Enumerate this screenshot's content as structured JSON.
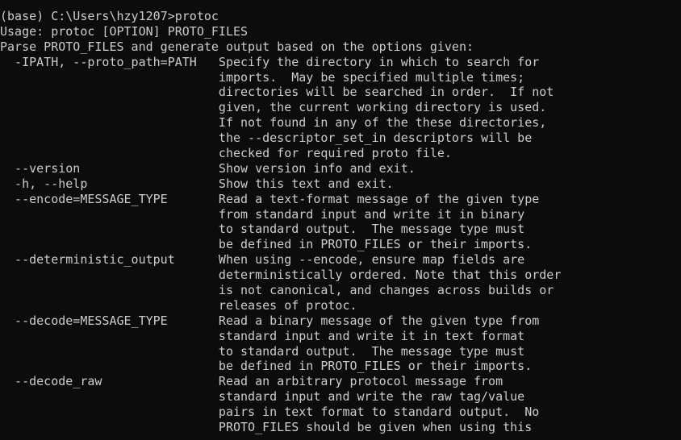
{
  "terminal": {
    "background_color": "#0c0c0c",
    "text_color": "#cccccc",
    "lines": [
      "(base) C:\\Users\\hzy1207>protoc",
      "Usage: protoc [OPTION] PROTO_FILES",
      "Parse PROTO_FILES and generate output based on the options given:",
      "  -IPATH, --proto_path=PATH   Specify the directory in which to search for",
      "                              imports.  May be specified multiple times;",
      "                              directories will be searched in order.  If not",
      "                              given, the current working directory is used.",
      "                              If not found in any of the these directories,",
      "                              the --descriptor_set_in descriptors will be",
      "                              checked for required proto file.",
      "  --version                   Show version info and exit.",
      "  -h, --help                  Show this text and exit.",
      "  --encode=MESSAGE_TYPE       Read a text-format message of the given type",
      "                              from standard input and write it in binary",
      "                              to standard output.  The message type must",
      "                              be defined in PROTO_FILES or their imports.",
      "  --deterministic_output      When using --encode, ensure map fields are",
      "                              deterministically ordered. Note that this order",
      "                              is not canonical, and changes across builds or",
      "                              releases of protoc.",
      "  --decode=MESSAGE_TYPE       Read a binary message of the given type from",
      "                              standard input and write it in text format",
      "                              to standard output.  The message type must",
      "                              be defined in PROTO_FILES or their imports.",
      "  --decode_raw                Read an arbitrary protocol message from",
      "                              standard input and write the raw tag/value",
      "                              pairs in text format to standard output.  No",
      "                              PROTO_FILES should be given when using this"
    ]
  }
}
